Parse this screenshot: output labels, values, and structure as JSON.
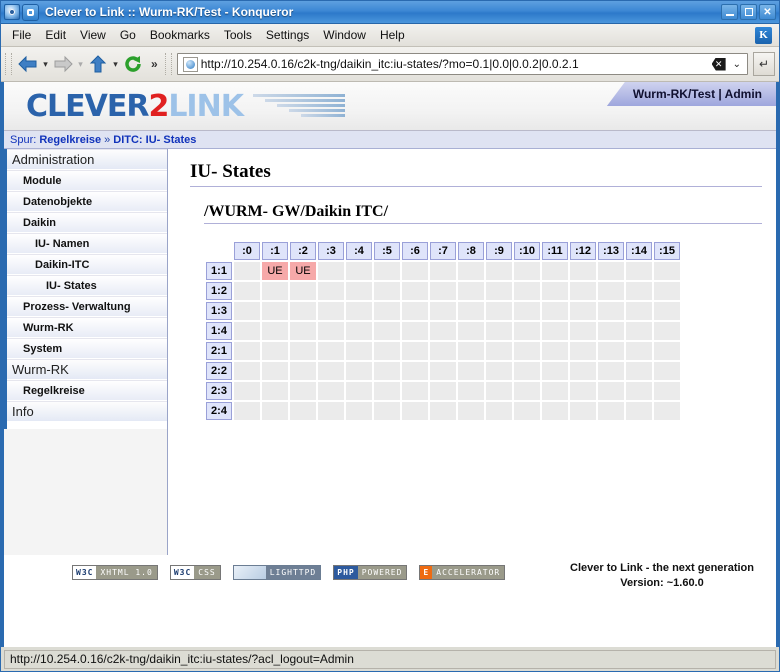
{
  "window": {
    "title": "Clever to Link :: Wurm-RK/Test - Konqueror",
    "minimize_label": "Minimize",
    "maximize_label": "Maximize",
    "close_label": "✕"
  },
  "menubar": {
    "items": [
      {
        "label": "File"
      },
      {
        "label": "Edit"
      },
      {
        "label": "View"
      },
      {
        "label": "Go"
      },
      {
        "label": "Bookmarks"
      },
      {
        "label": "Tools"
      },
      {
        "label": "Settings"
      },
      {
        "label": "Window"
      },
      {
        "label": "Help"
      }
    ],
    "kde_logo": "K"
  },
  "toolbar": {
    "back_label": "Back",
    "forward_label": "Forward",
    "up_label": "Up",
    "reload_label": "Reload",
    "overflow_label": "»",
    "url": "http://10.254.0.16/c2k-tng/daikin_itc:iu-states/?mo=0.1|0.0|0.0.2|0.0.2.1",
    "clear_label": "✕",
    "dropdown_label": "⌄",
    "go_label": "↵"
  },
  "brand": {
    "logo_part1": "CLEVER",
    "logo_part2": "2",
    "logo_part3": "LINK",
    "account": "Wurm-RK/Test | Admin"
  },
  "breadcrumb": {
    "prefix": "Spur:",
    "first": "Regelkreise",
    "separator": "»",
    "second": "DITC: IU- States"
  },
  "sidebar": {
    "items": [
      {
        "label": "Administration",
        "level": 0
      },
      {
        "label": "Module",
        "level": 1
      },
      {
        "label": "Datenobjekte",
        "level": 1
      },
      {
        "label": "Daikin",
        "level": 1
      },
      {
        "label": "IU- Namen",
        "level": 2
      },
      {
        "label": "Daikin-ITC",
        "level": 2
      },
      {
        "label": "IU- States",
        "level": 3
      },
      {
        "label": "Prozess- Verwaltung",
        "level": 1
      },
      {
        "label": "Wurm-RK",
        "level": 1
      },
      {
        "label": "System",
        "level": 1
      },
      {
        "label": "Wurm-RK",
        "level": 0
      },
      {
        "label": "Regelkreise",
        "level": 1
      },
      {
        "label": "Info",
        "level": 0
      }
    ]
  },
  "main": {
    "heading": "IU- States",
    "subheading": "/WURM- GW/Daikin ITC/",
    "grid": {
      "columns": [
        ":0",
        ":1",
        ":2",
        ":3",
        ":4",
        ":5",
        ":6",
        ":7",
        ":8",
        ":9",
        ":10",
        ":11",
        ":12",
        ":13",
        ":14",
        ":15"
      ],
      "rows": [
        {
          "label": "1:1",
          "cells": [
            "",
            "UE",
            "UE",
            "",
            "",
            "",
            "",
            "",
            "",
            "",
            "",
            "",
            "",
            "",
            "",
            ""
          ]
        },
        {
          "label": "1:2",
          "cells": [
            "",
            "",
            "",
            "",
            "",
            "",
            "",
            "",
            "",
            "",
            "",
            "",
            "",
            "",
            "",
            ""
          ]
        },
        {
          "label": "1:3",
          "cells": [
            "",
            "",
            "",
            "",
            "",
            "",
            "",
            "",
            "",
            "",
            "",
            "",
            "",
            "",
            "",
            ""
          ]
        },
        {
          "label": "1:4",
          "cells": [
            "",
            "",
            "",
            "",
            "",
            "",
            "",
            "",
            "",
            "",
            "",
            "",
            "",
            "",
            "",
            ""
          ]
        },
        {
          "label": "2:1",
          "cells": [
            "",
            "",
            "",
            "",
            "",
            "",
            "",
            "",
            "",
            "",
            "",
            "",
            "",
            "",
            "",
            ""
          ]
        },
        {
          "label": "2:2",
          "cells": [
            "",
            "",
            "",
            "",
            "",
            "",
            "",
            "",
            "",
            "",
            "",
            "",
            "",
            "",
            "",
            ""
          ]
        },
        {
          "label": "2:3",
          "cells": [
            "",
            "",
            "",
            "",
            "",
            "",
            "",
            "",
            "",
            "",
            "",
            "",
            "",
            "",
            "",
            ""
          ]
        },
        {
          "label": "2:4",
          "cells": [
            "",
            "",
            "",
            "",
            "",
            "",
            "",
            "",
            "",
            "",
            "",
            "",
            "",
            "",
            "",
            ""
          ]
        }
      ]
    }
  },
  "footer": {
    "badges": [
      {
        "left": "W3C",
        "right": "XHTML 1.0",
        "cls": "b-xhtml"
      },
      {
        "left": "W3C",
        "right": "CSS",
        "cls": "b-css"
      },
      {
        "left": "",
        "right": "LIGHTTPD",
        "cls": "b-lighttpd"
      },
      {
        "left": "PHP",
        "right": "POWERED",
        "cls": "b-php"
      },
      {
        "left": "E",
        "right": "ACCELERATOR",
        "cls": "b-eacc"
      }
    ],
    "tagline": "Clever to Link - the next generation",
    "version": "Version: ~1.60.0"
  },
  "statusbar": {
    "text": "http://10.254.0.16/c2k-tng/daikin_itc:iu-states/?acl_logout=Admin"
  },
  "colors": {
    "title_blue": "#3c87d4",
    "page_border": "#2a6ab0",
    "header_cell": "#dfe4fa",
    "cell": "#ebebeb",
    "ue_cell": "#f6a9a9",
    "link": "#1133bb",
    "logo_blue": "#2b63ab",
    "logo_red": "#e02020",
    "logo_light": "#9dc2e8"
  }
}
